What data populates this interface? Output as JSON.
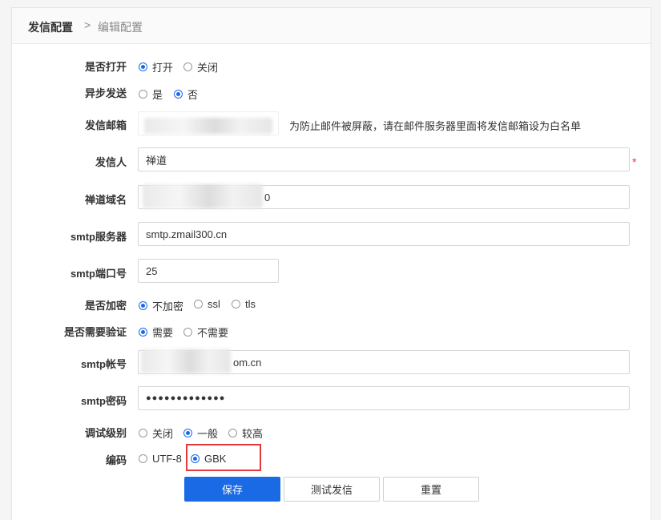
{
  "breadcrumb": {
    "main": "发信配置",
    "separator": ">",
    "sub": "编辑配置"
  },
  "form": {
    "turn_on": {
      "label": "是否打开",
      "options": [
        "打开",
        "关闭"
      ],
      "selected": 0
    },
    "async_send": {
      "label": "异步发送",
      "options": [
        "是",
        "否"
      ],
      "selected": 1
    },
    "sender_email": {
      "label": "发信邮箱",
      "value": "",
      "hint": "为防止邮件被屏蔽，请在邮件服务器里面将发信邮箱设为白名单"
    },
    "sender_name": {
      "label": "发信人",
      "value": "禅道",
      "required_mark": "*"
    },
    "domain": {
      "label": "禅道域名",
      "value": "0"
    },
    "smtp_server": {
      "label": "smtp服务器",
      "value": "smtp.zmail300.cn"
    },
    "smtp_port": {
      "label": "smtp端口号",
      "value": "25"
    },
    "encryption": {
      "label": "是否加密",
      "options": [
        "不加密",
        "ssl",
        "tls"
      ],
      "selected": 0
    },
    "auth": {
      "label": "是否需要验证",
      "options": [
        "需要",
        "不需要"
      ],
      "selected": 0
    },
    "smtp_account": {
      "label": "smtp帐号",
      "value": "om.cn"
    },
    "smtp_password": {
      "label": "smtp密码",
      "value": "●●●●●●●●●●●●●"
    },
    "debug_level": {
      "label": "调试级别",
      "options": [
        "关闭",
        "一般",
        "较高"
      ],
      "selected": 1
    },
    "charset": {
      "label": "编码",
      "options": [
        "UTF-8",
        "GBK"
      ],
      "selected": 1
    }
  },
  "buttons": {
    "save": "保存",
    "test": "测试发信",
    "reset": "重置"
  },
  "colors": {
    "accent": "#1a6ae6",
    "highlight": "#e4393c"
  }
}
